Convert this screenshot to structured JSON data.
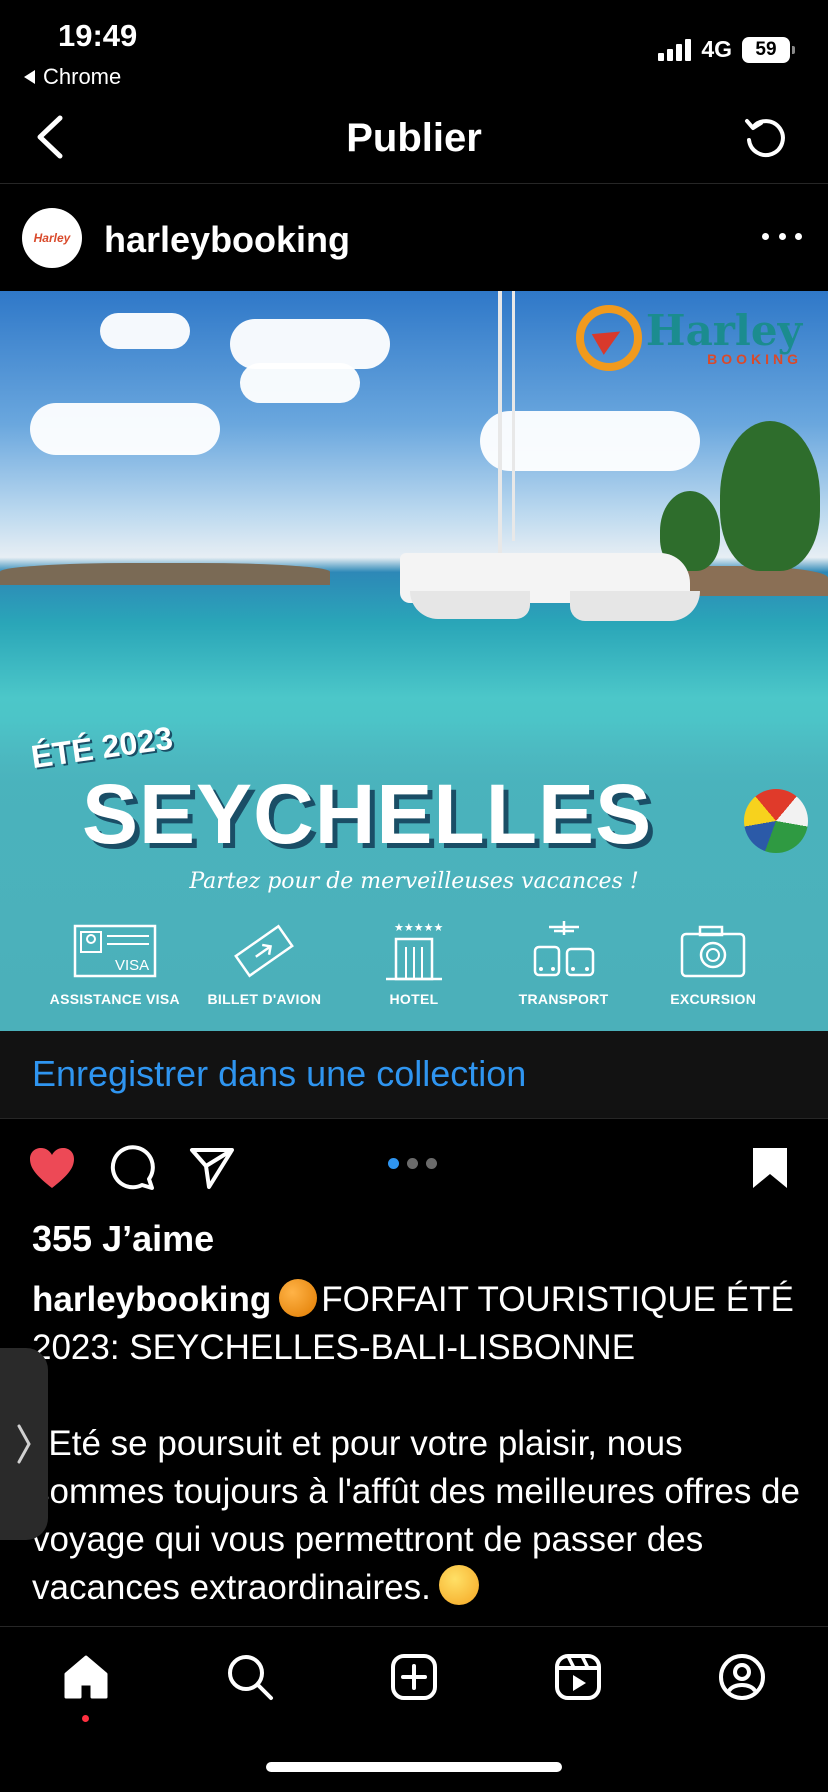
{
  "status_bar": {
    "time": "19:49",
    "back_app": "Chrome",
    "network": "4G",
    "battery": "59"
  },
  "header": {
    "title": "Publier"
  },
  "post": {
    "username": "harleybooking",
    "avatar_text": "Harley",
    "image": {
      "logo_main": "Harley",
      "logo_sub": "BOOKING",
      "season": "ÉTÉ 2023",
      "headline": "SEYCHELLES",
      "tagline": "Partez pour de merveilleuses vacances !",
      "services": [
        {
          "label": "ASSISTANCE VISA",
          "badge": "VISA",
          "icon": "visa-card-icon"
        },
        {
          "label": "BILLET D'AVION",
          "icon": "plane-ticket-icon"
        },
        {
          "label": "HOTEL",
          "icon": "hotel-icon"
        },
        {
          "label": "TRANSPORT",
          "icon": "transport-icon"
        },
        {
          "label": "EXCURSION",
          "icon": "camera-icon"
        }
      ]
    },
    "save_collection": "Enregistrer dans une collection",
    "carousel": {
      "total": 3,
      "active": 1
    },
    "likes": "355 J’aime",
    "caption": {
      "user": "harleybooking",
      "line1": "FORFAIT TOURISTIQUE ÉTÉ 2023: SEYCHELLES-BALI-LISBONNE",
      "paragraph": ".'Eté se poursuit et pour votre plaisir, nous sommes toujours à l'affût des meilleures offres de voyage qui vous permettront de passer des vacances extraordinaires."
    }
  },
  "colors": {
    "link_blue": "#2f95f0",
    "like_red": "#ed4956",
    "background": "#000000"
  },
  "tabbar": {
    "tabs": [
      "home-icon",
      "search-icon",
      "create-icon",
      "reels-icon",
      "profile-icon"
    ]
  }
}
